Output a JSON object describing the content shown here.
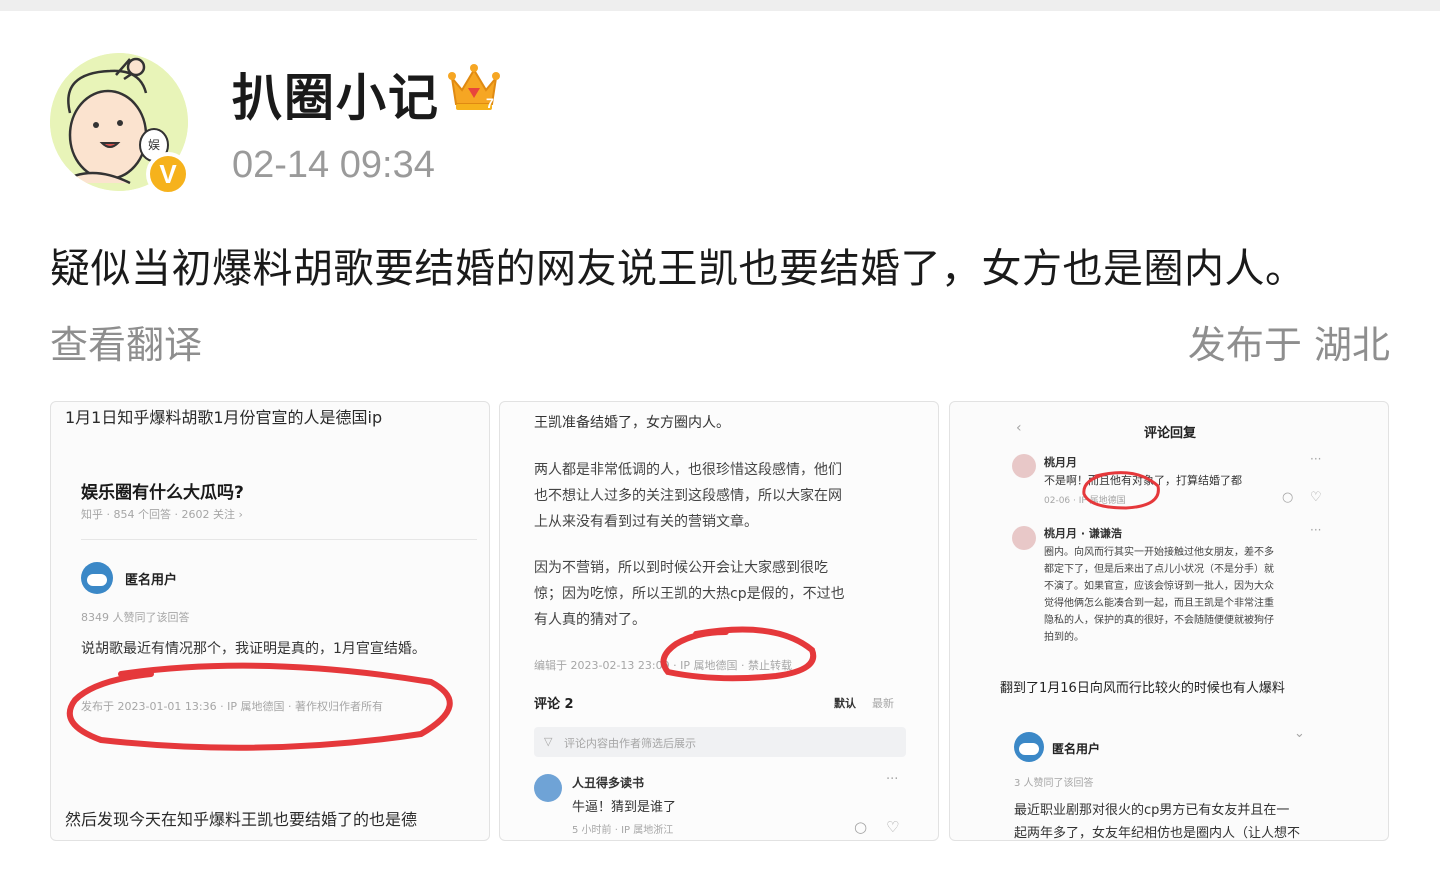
{
  "header": {
    "username": "扒圈小记",
    "timestamp": "02-14 09:34",
    "verified_badge": "V",
    "avatar_text": "娱",
    "crown_color": "#f6a623",
    "badge_color": "#f6b21c"
  },
  "post": {
    "text": "疑似当初爆料胡歌要结婚的网友说王凯也要结婚了，女方也是圈内人。",
    "translate_label": "查看翻译",
    "location": "发布于 湖北"
  },
  "images": [
    {
      "title": "1月1日知乎爆料胡歌1月份官宣的人是德国ip",
      "question": "娱乐圈有什么大瓜吗?",
      "question_meta": "知乎 · 854 个回答 · 2602 关注 ›",
      "user": "匿名用户",
      "likes": "8349 人赞同了该回答",
      "answer": "说胡歌最近有情况那个，我证明是真的，1月官宣结婚。",
      "posted": "发布于 2023-01-01 13:36 · IP 属地德国 · 著作权归作者所有",
      "footer": "然后发现今天在知乎爆料王凯也要结婚了的也是德"
    },
    {
      "line1": "王凯准备结婚了，女方圈内人。",
      "para1": [
        "两人都是非常低调的人，也很珍惜这段感情，他们",
        "也不想让人过多的关注到这段感情，所以大家在网",
        "上从来没有看到过有关的营销文章。"
      ],
      "para2": [
        "因为不营销，所以到时候公开会让大家感到很吃",
        "惊；因为吃惊，所以王凯的大热cp是假的，不过也",
        "有人真的猜对了。"
      ],
      "edited": "编辑于 2023-02-13 23:09 · IP 属地德国 · 禁止转载",
      "comments_label": "评论 2",
      "sort_default": "默认",
      "sort_latest": "最新",
      "filter_note": "评论内容由作者筛选后展示",
      "commenter": "人丑得多读书",
      "comment_text": "牛逼！猜到是谁了",
      "comment_meta": "5 小时前 · IP 属地浙江"
    },
    {
      "header_title": "评论回复",
      "c1_user": "桃月月",
      "c1_text": "不是啊！而且他有对象了，打算结婚了都",
      "c1_meta": "02-06 · IP 属地德国",
      "c2_user": "桃月月 · 谦谦浩",
      "c2_lines": [
        "圈内。向风而行其实一开始接触过他女朋友，差不多",
        "都定下了，但是后来出了点儿小状况（不是分手）就",
        "不演了。如果官宣，应该会惊讶到一批人，因为大众",
        "觉得他俩怎么能凑合到一起，而且王凯是个非常注重",
        "隐私的人，保护的真的很好，不会随随便便就被狗仔",
        "拍到的。"
      ],
      "caption": "翻到了1月16日向风而行比较火的时候也有人爆料",
      "user": "匿名用户",
      "likes": "3 人赞同了该回答",
      "body": [
        "最近职业剧那对很火的cp男方已有女友并且在一",
        "起两年多了，女友年纪相仿也是圈内人（让人想不"
      ]
    }
  ]
}
